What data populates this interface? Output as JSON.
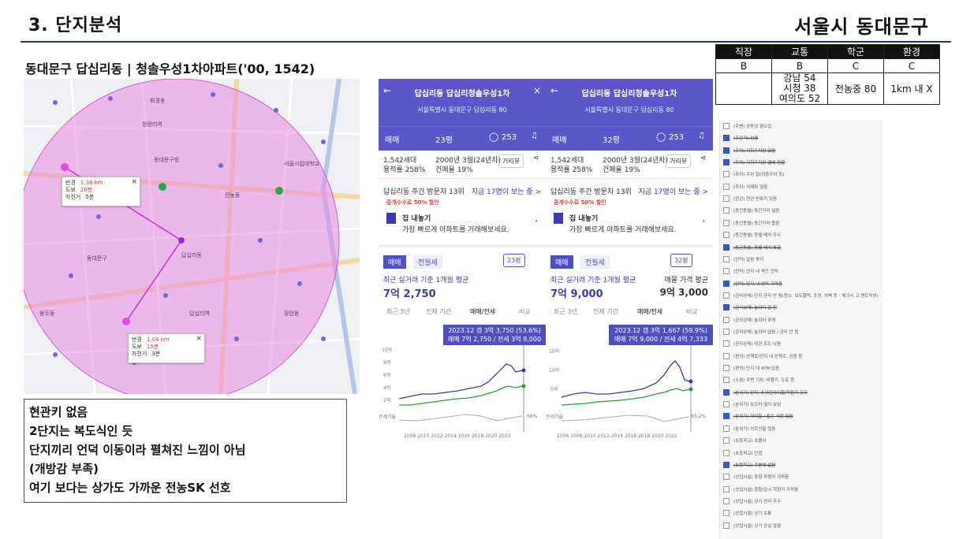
{
  "header": {
    "section_title": "3. 단지분석",
    "region": "서울시 동대문구",
    "apt_title": "동대문구 답십리동 | 청솔우성1차아파트('00, 1542)"
  },
  "map": {
    "popup1": {
      "k1": "반경",
      "v1": "1.38 km",
      "k2": "도보",
      "v2": "20분",
      "k3": "자전거",
      "v3": "5분"
    },
    "popup2": {
      "k1": "반경",
      "v1": "1.04 km",
      "k2": "도보",
      "v2": "15분",
      "k3": "자전거",
      "v3": "3분"
    },
    "labels": [
      "답십리동",
      "청량리역",
      "전농동",
      "동대문구청",
      "답십리역",
      "동대문구",
      "서울시립대학교",
      "장안동",
      "휘경동",
      "용두동"
    ]
  },
  "note": {
    "lines": [
      "현관키 없음",
      "2단지는 복도식인 듯",
      "단지끼리 언덕 이동이라 펼쳐진 느낌이 아님",
      "(개방감 부족)",
      "여기 보다는 상가도 가까운 전농SK 선호"
    ]
  },
  "panels": [
    {
      "title": "답십리동 답십리청솔우성1차",
      "address": "서울특별시 동대문구 답십리동 80",
      "deal_type": "매매",
      "size": "23평",
      "comments": "253",
      "households": "1,542세대",
      "floor_ratio": "용적률 258%",
      "built": "2000년 3월(24년차)",
      "coverage": "건폐율 19%",
      "view_btn": "거리뷰",
      "visitors": "답십리동 주간 방문자 13위",
      "now": "지금 17명이 보는 중 >",
      "promo_badge": "중개수수료 50% 할인",
      "promo_title": "집 내놓기",
      "promo_desc": "가장 빠르게 아파트를 거래해보세요.",
      "tab1": "매매",
      "tab2": "전월세",
      "size_sel": "23평",
      "avg_label": "최근 실거래 기준 1개월 평균",
      "avg_price": "7억 2,750",
      "ask_label": "",
      "ask_price": "",
      "range_tabs": [
        "최근 3년",
        "전체 기간",
        "매매/전세",
        "비교"
      ],
      "tip1": "2023.12 갭 3억 3,750 (53.6%)",
      "tip2": "매매 7억 2,750 / 전세 3억 9,000",
      "y_ticks": [
        "10억",
        "8억",
        "6억",
        "4억",
        "2억"
      ],
      "ratio_label": "전세가율",
      "ratio_val": "66%",
      "x_ticks": "2008 2010 2012 2014 2016 2018 2020 2022"
    },
    {
      "title": "답십리동 답십리청솔우성1차",
      "address": "서울특별시 동대문구 답십리동 80",
      "deal_type": "매매",
      "size": "32평",
      "comments": "253",
      "households": "1,542세대",
      "floor_ratio": "용적률 258%",
      "built": "2000년 3월(24년차)",
      "coverage": "건폐율 19%",
      "view_btn": "거리뷰",
      "visitors": "답십리동 주간 방문자 13위",
      "now": "지금 17명이 보는 중 >",
      "promo_badge": "중개수수료 50% 할인",
      "promo_title": "집 내놓기",
      "promo_desc": "가장 빠르게 아파트를 거래해보세요.",
      "tab1": "매매",
      "tab2": "전월세",
      "size_sel": "32평",
      "avg_label": "최근 실거래 기준 1개월 평균",
      "avg_price": "7억 9,000",
      "ask_label": "매물 가격 평균",
      "ask_price": "9억 3,000",
      "range_tabs": [
        "최근 3년",
        "전체 기간",
        "매매/전세",
        "비교"
      ],
      "tip1": "2023.12 갭 3억 1,667 (59.9%)",
      "tip2": "매매 7억 9,000 / 전세 4억 7,333",
      "y_ticks": [
        "15억",
        "10억",
        "5억"
      ],
      "ratio_label": "전세가율",
      "ratio_val": "65.2%",
      "x_ticks": "2006 2008 2010 2012 2014 2016 2018 2020 2022"
    }
  ],
  "criteria": {
    "headers": [
      "직장",
      "교통",
      "학군",
      "환경"
    ],
    "grades": [
      "B",
      "B",
      "C",
      "C"
    ],
    "details": [
      "",
      "강남 54\n시청 38\n여의도 52",
      "전농중 80",
      "1km 내 X"
    ]
  },
  "checklist": [
    {
      "t": "(주변) 공동성 혐오입",
      "on": false
    },
    {
      "t": "(주간거) 임종",
      "on": true
    },
    {
      "t": "(주차) 지하주차장 있음",
      "on": true
    },
    {
      "t": "(주차) 지하주차장 엘베 연결",
      "on": true
    },
    {
      "t": "(주차) 주차 협(이중주차 등)",
      "on": false
    },
    {
      "t": "(주차) 외제차 많음",
      "on": false
    },
    {
      "t": "(현관) 현관 번호키 있음",
      "on": false
    },
    {
      "t": "(동간동별) 동간거리 넓음",
      "on": false
    },
    {
      "t": "(동간동별) 동간거리 좁음",
      "on": false
    },
    {
      "t": "(동간동별) 동별 배치 우수",
      "on": false
    },
    {
      "t": "(동간동별) 동별 배치 복잡",
      "on": true
    },
    {
      "t": "(언덕) 없음 평지",
      "on": false
    },
    {
      "t": "(언덕) 단지 내 약간 언덕",
      "on": false
    },
    {
      "t": "(언덕) 단지 내 언덕 가파름",
      "on": true
    },
    {
      "t": "(관리상태) 단지 관리 안 됨(청소, 보도블럭, 조경, 외벽 등 - 체크시 고 엔트작성)",
      "on": false
    },
    {
      "t": "(관리상태) 놀이터 잘 됨",
      "on": true
    },
    {
      "t": "(관리상태) 놀이터 포래",
      "on": false
    },
    {
      "t": "(관리상태) 놀이터 없음 / 관리 안 됨",
      "on": false
    },
    {
      "t": "(관리상태) 여관 조도 낮음",
      "on": false
    },
    {
      "t": "(편의) 산책로/단지 내 산책로, 공원 등",
      "on": false
    },
    {
      "t": "(편의) 단지 내 ATM 있음",
      "on": false
    },
    {
      "t": "(소음) 주변 기차, 비행기, 도로 등",
      "on": false
    },
    {
      "t": "(분위기) 단지 내 어린아이들/학원가 유무",
      "on": true
    },
    {
      "t": "(분위기) 유모차 많이 보임",
      "on": false
    },
    {
      "t": "(분위기) 아이들 / 젊은 사람 많음",
      "on": true
    },
    {
      "t": "(분위기) 어르신들 많음",
      "on": false
    },
    {
      "t": "(초등학교) 초품아",
      "on": false
    },
    {
      "t": "(초등학교) 인접",
      "on": false
    },
    {
      "t": "(초등학교) 주변에 없음",
      "on": true
    },
    {
      "t": "(상업시설) 중형 학원가 가까움",
      "on": false
    },
    {
      "t": "(상업시설) 중형/입시 학원가 가까움",
      "on": false
    },
    {
      "t": "(상업시설) 상가 관리 우수",
      "on": false
    },
    {
      "t": "(상업시설) 상가 보통",
      "on": false
    },
    {
      "t": "(상업시설) 상가 공실 많음",
      "on": false
    }
  ]
}
